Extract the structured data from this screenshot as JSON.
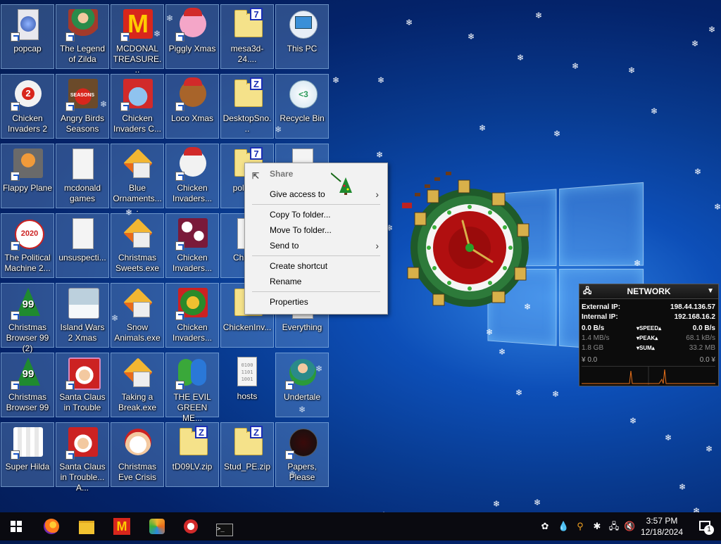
{
  "desktop": {
    "icons": [
      {
        "label": "popcap"
      },
      {
        "label": "The Legend of Zilda"
      },
      {
        "label": "MCDONAL TREASURE..."
      },
      {
        "label": "Piggly Xmas"
      },
      {
        "label": "mesa3d-24...."
      },
      {
        "label": "This PC"
      },
      {
        "label": "Chicken Invaders 2"
      },
      {
        "label": "Angry Birds Seasons"
      },
      {
        "label": "Chicken Invaders C..."
      },
      {
        "label": "Loco Xmas"
      },
      {
        "label": "DesktopSno..."
      },
      {
        "label": "Recycle Bin"
      },
      {
        "label": "Flappy Plane"
      },
      {
        "label": "mcdonald games"
      },
      {
        "label": "Blue Ornaments...."
      },
      {
        "label": "Chicken Invaders..."
      },
      {
        "label": "politic..."
      },
      {
        "label": "The Political Machine 2..."
      },
      {
        "label": "unsuspecti..."
      },
      {
        "label": "Christmas Sweets.exe"
      },
      {
        "label": "Chicken Invaders..."
      },
      {
        "label": "Chick..."
      },
      {
        "label": "Christmas Browser 99 (2)"
      },
      {
        "label": "Island Wars 2 Xmas"
      },
      {
        "label": "Snow Animals.exe"
      },
      {
        "label": "Chicken Invaders..."
      },
      {
        "label": "ChickenInv..."
      },
      {
        "label": "Everything"
      },
      {
        "label": "Christmas Browser 99"
      },
      {
        "label": "Santa Claus in Trouble"
      },
      {
        "label": "Taking a Break.exe"
      },
      {
        "label": "THE EVIL GREEN ME..."
      },
      {
        "label": "hosts"
      },
      {
        "label": "Undertale"
      },
      {
        "label": "Super Hilda"
      },
      {
        "label": "Santa Claus in Trouble... A..."
      },
      {
        "label": "Christmas Eve Crisis"
      },
      {
        "label": "tD09LV.zip"
      },
      {
        "label": "Stud_PE.zip"
      },
      {
        "label": "Papers, Please"
      }
    ],
    "icon_badges": {
      "cv_badge": "2",
      "ab_badge": "SEASONS",
      "pol_badge": "2020",
      "cb_badge": "99",
      "zip_z": "Z",
      "zip_7": "7",
      "rb_text": "<3",
      "hosts_bits": "0100 1101 1001"
    }
  },
  "context_menu": {
    "share": "Share",
    "give_access": "Give access to",
    "copy_to": "Copy To folder...",
    "move_to": "Move To folder...",
    "send_to": "Send to",
    "create_shortcut": "Create shortcut",
    "rename": "Rename",
    "properties": "Properties"
  },
  "network_meter": {
    "title": "NETWORK",
    "external_ip_label": "External IP:",
    "external_ip": "198.44.136.57",
    "internal_ip_label": "Internal IP:",
    "internal_ip": "192.168.16.2",
    "speed_down": "0.0 B/s",
    "speed_label": "SPEED",
    "speed_up": "0.0 B/s",
    "peak_down": "1.4 MB/s",
    "peak_label": "PEAK",
    "peak_up": "68.1 kB/s",
    "sum_down": "1.8 GB",
    "sum_label": "SUM",
    "sum_up": "33.2 MB",
    "graph_left": "0.0",
    "graph_right": "0.0"
  },
  "taskbar": {
    "time": "3:57 PM",
    "date": "12/18/2024",
    "notification_count": "1"
  },
  "colors": {
    "selection": "#7aa0d2",
    "taskbar": "#0a0a10"
  }
}
